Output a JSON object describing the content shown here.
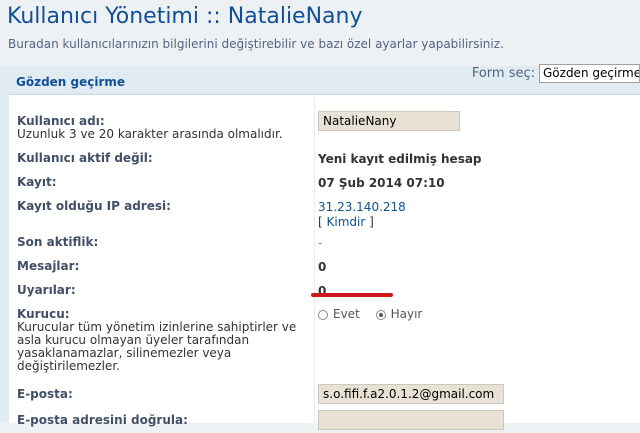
{
  "header": {
    "title": "Kullanıcı Yönetimi :: NatalieNany",
    "description": "Buradan kullanıcılarınızın bilgilerini değiştirebilir ve bazı özel ayarlar yapabilirsiniz."
  },
  "form_select": {
    "label": "Form seç:",
    "selected": "Gözden geçirme"
  },
  "panel": {
    "title": "Gözden geçirme"
  },
  "fields": {
    "username": {
      "label": "Kullanıcı adı:",
      "hint": "Uzunluk 3 ve 20 karakter arasında olmalıdır.",
      "value": "NatalieNany"
    },
    "inactive": {
      "label": "Kullanıcı aktif değil:",
      "value": "Yeni kayıt edilmiş hesap"
    },
    "registered": {
      "label": "Kayıt:",
      "value": "07 Şub 2014 07:10"
    },
    "reg_ip": {
      "label": "Kayıt olduğu IP adresi:",
      "ip": "31.23.140.218",
      "whois_open": "[",
      "whois_link": "Kimdir",
      "whois_close": "]"
    },
    "last_active": {
      "label": "Son aktiflik:",
      "value": "-"
    },
    "posts": {
      "label": "Mesajlar:",
      "value": "0"
    },
    "warnings": {
      "label": "Uyarılar:",
      "value": "0"
    },
    "founder": {
      "label": "Kurucu:",
      "hint": "Kurucular tüm yönetim izinlerine sahiptirler ve asla kurucu olmayan üyeler tarafından yasaklanamazlar, silinemezler veya değiştirilemezler.",
      "options": [
        "Evet",
        "Hayır"
      ],
      "selected": "Hayır"
    },
    "email": {
      "label": "E-posta:",
      "value": "s.o.fifi.f.a2.0.1.2@gmail.com"
    },
    "email_confirm": {
      "label": "E-posta adresini doğrula:",
      "value": ""
    }
  },
  "colors": {
    "title": "#115098",
    "panel_bg": "#e1ebf2",
    "annotation": "#d0181c"
  }
}
